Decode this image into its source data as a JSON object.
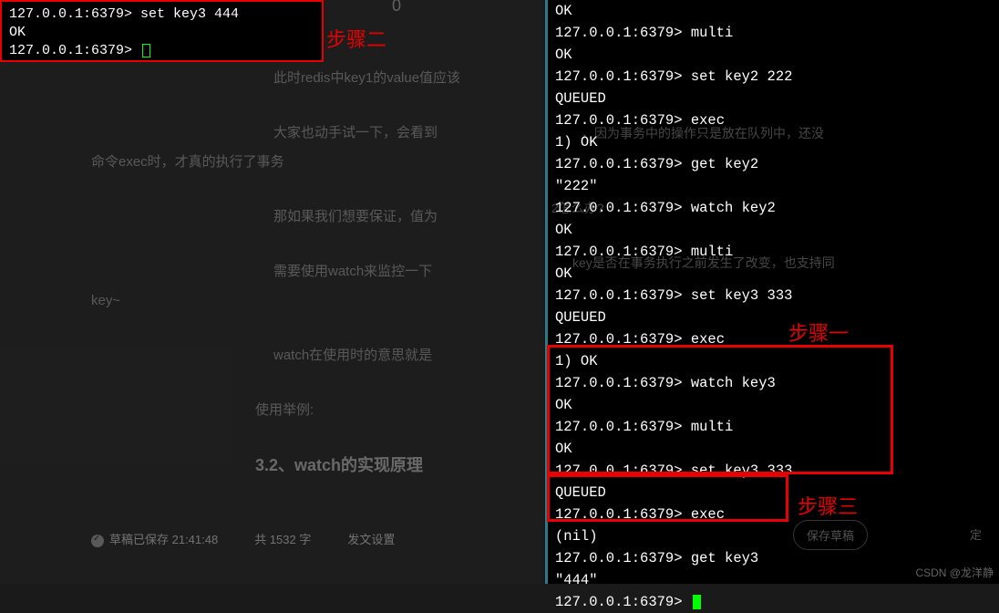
{
  "left_terminal": {
    "line1_prompt": "127.0.0.1:6379>",
    "line1_cmd": " set key3 444",
    "line2": "OK",
    "line3_prompt": "127.0.0.1:6379>"
  },
  "annotations": {
    "step1": "步骤一",
    "step2": "步骤二",
    "step3": "步骤三"
  },
  "article": {
    "zero": "0",
    "p1": "此时redis中key1的value值应该",
    "p2a": "大家也动手试一下，会看到",
    "p2b": "命令exec时，才真的执行了事务",
    "p3": "那如果我们想要保证，值为",
    "p4a": "需要使用watch来监控一下",
    "p4b": "key~",
    "p5": "watch在使用时的意思就是",
    "p6": "使用举例:",
    "heading": "3.2、watch的实现原理"
  },
  "bottom": {
    "draft_saved": "草稿已保存 21:41:48",
    "word_count": "共 1532 字",
    "publish_settings": "发文设置",
    "save_draft_btn": "保存草稿",
    "publish_btn": "定"
  },
  "overlay": {
    "o1a": "，因为事务中的操作只是放在队列中，还没",
    "o1b": "2怎么办?",
    "o1c": "key是否在事务执行之前发生了改变，也支持同"
  },
  "right_terminal": {
    "lines": [
      "OK",
      "127.0.0.1:6379> multi",
      "OK",
      "127.0.0.1:6379> set key2 222",
      "QUEUED",
      "127.0.0.1:6379> exec",
      "1) OK",
      "127.0.0.1:6379> get key2",
      "\"222\"",
      "127.0.0.1:6379> watch key2",
      "OK",
      "127.0.0.1:6379> multi",
      "OK",
      "127.0.0.1:6379> set key3 333",
      "QUEUED",
      "127.0.0.1:6379> exec",
      "1) OK",
      "127.0.0.1:6379> watch key3",
      "OK",
      "127.0.0.1:6379> multi",
      "OK",
      "127.0.0.1:6379> set key3 333",
      "QUEUED",
      "127.0.0.1:6379> exec",
      "(nil)",
      "127.0.0.1:6379> get key3",
      "\"444\"",
      "127.0.0.1:6379> "
    ]
  },
  "watermark": "CSDN @龙洋静"
}
